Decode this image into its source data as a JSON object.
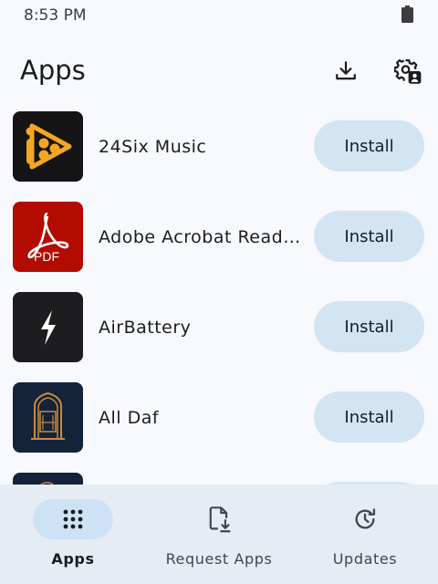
{
  "status_bar": {
    "time": "8:53 PM",
    "battery_icon": "battery-icon"
  },
  "header": {
    "title": "Apps",
    "download_icon": "download-icon",
    "settings_icon": "settings-account-icon"
  },
  "apps": [
    {
      "name": "24Six Music",
      "button_label": "Install",
      "icon": "24six-music-icon"
    },
    {
      "name": "Adobe Acrobat Reader: Edit PDF",
      "display_name": "Adobe Acrobat Reader:…",
      "button_label": "Install",
      "icon": "adobe-acrobat-icon",
      "icon_text": "PDF"
    },
    {
      "name": "AirBattery",
      "button_label": "Install",
      "icon": "airbattery-icon"
    },
    {
      "name": "All Daf",
      "button_label": "Install",
      "icon": "all-daf-icon"
    }
  ],
  "bottom_nav": {
    "items": [
      {
        "label": "Apps",
        "icon": "apps-grid-icon",
        "active": true
      },
      {
        "label": "Request Apps",
        "icon": "request-file-icon",
        "active": false
      },
      {
        "label": "Updates",
        "icon": "update-history-icon",
        "active": false
      }
    ]
  },
  "colors": {
    "background": "#f7f9fd",
    "install_button": "#d3e4f2",
    "nav_background": "#e6ecf4",
    "nav_active_pill": "#cde3f5",
    "acrobat_red": "#b30b00",
    "six_orange": "#f5a623"
  }
}
